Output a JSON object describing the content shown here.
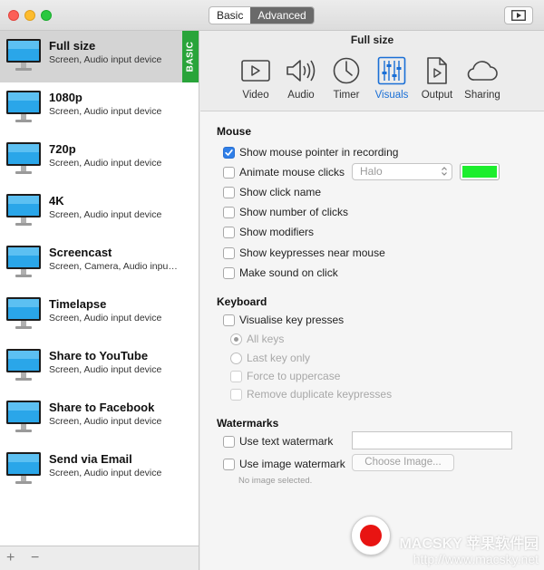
{
  "titlebar": {
    "modes": [
      {
        "label": "Basic",
        "active": false
      },
      {
        "label": "Advanced",
        "active": true
      }
    ],
    "preview_icon": "play-window-icon"
  },
  "sidebar": {
    "presets": [
      {
        "title": "Full size",
        "subtitle": "Screen, Audio input device",
        "selected": true,
        "badge": "BASIC"
      },
      {
        "title": "1080p",
        "subtitle": "Screen, Audio input device"
      },
      {
        "title": "720p",
        "subtitle": "Screen, Audio input device"
      },
      {
        "title": "4K",
        "subtitle": "Screen, Audio input device"
      },
      {
        "title": "Screencast",
        "subtitle": "Screen, Camera, Audio inpu…"
      },
      {
        "title": "Timelapse",
        "subtitle": "Screen, Audio input device"
      },
      {
        "title": "Share to YouTube",
        "subtitle": "Screen, Audio input device"
      },
      {
        "title": "Share to Facebook",
        "subtitle": "Screen, Audio input device"
      },
      {
        "title": "Send via Email",
        "subtitle": "Screen, Audio input device"
      }
    ],
    "footer": {
      "add": "+",
      "remove": "−"
    }
  },
  "main": {
    "preset_name": "Full size",
    "tabs": [
      {
        "label": "Video",
        "icon": "video-icon"
      },
      {
        "label": "Audio",
        "icon": "speaker-icon"
      },
      {
        "label": "Timer",
        "icon": "clock-icon"
      },
      {
        "label": "Visuals",
        "icon": "sliders-icon",
        "active": true
      },
      {
        "label": "Output",
        "icon": "output-file-icon"
      },
      {
        "label": "Sharing",
        "icon": "cloud-icon"
      }
    ],
    "mouse": {
      "heading": "Mouse",
      "show_pointer": "Show mouse pointer in recording",
      "animate_clicks": "Animate mouse clicks",
      "click_style": "Halo",
      "click_color": "#1cee2d",
      "show_click_name": "Show click name",
      "show_click_count": "Show number of clicks",
      "show_modifiers": "Show modifiers",
      "show_keypresses": "Show keypresses near mouse",
      "make_sound": "Make sound on click"
    },
    "keyboard": {
      "heading": "Keyboard",
      "visualise": "Visualise key presses",
      "all_keys": "All keys",
      "last_key": "Last key only",
      "force_upper": "Force to uppercase",
      "remove_dupes": "Remove duplicate keypresses"
    },
    "watermarks": {
      "heading": "Watermarks",
      "use_text": "Use text watermark",
      "text_value": "",
      "use_image": "Use image watermark",
      "choose_image": "Choose Image...",
      "no_image": "No image selected."
    }
  },
  "overlay_watermark": {
    "line1": "MACSKY 苹果软件园",
    "line2": "http://www.macsky.net"
  },
  "colors": {
    "accent": "#2f7fe8",
    "badge": "#29a43a",
    "record": "#e81412"
  }
}
